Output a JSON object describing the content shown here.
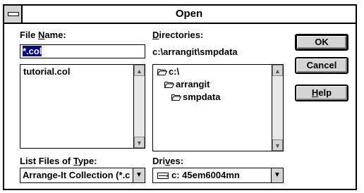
{
  "window": {
    "title": "Open"
  },
  "file_name": {
    "label_pre": "File ",
    "label_accel": "N",
    "label_post": "ame:",
    "value": "*.col"
  },
  "files_list": {
    "items": [
      "tutorial.col"
    ]
  },
  "directories": {
    "label_accel": "D",
    "label_post": "irectories:",
    "current_path": "c:\\arrangit\\smpdata",
    "items": [
      "c:\\",
      "arrangit",
      "smpdata"
    ]
  },
  "list_type": {
    "label_pre": "List Files of ",
    "label_accel": "T",
    "label_post": "ype:",
    "selected": "Arrange-It Collection (*.c"
  },
  "drives": {
    "label_pre": "Dri",
    "label_accel": "v",
    "label_post": "es:",
    "selected": "c: 45em6004mn"
  },
  "buttons": {
    "ok": "OK",
    "cancel": "Cancel",
    "help_accel": "H",
    "help_post": "elp"
  },
  "colors": {
    "selection": "#000080",
    "button_face": "#d4d4d4"
  }
}
